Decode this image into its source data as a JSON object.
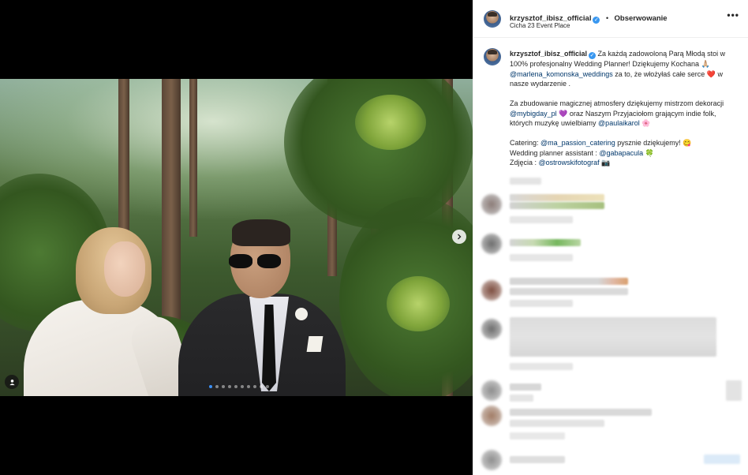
{
  "header": {
    "username": "krzysztof_ibisz_official",
    "verified_mark": "✓",
    "separator": "•",
    "follow_label": "Obserwowanie",
    "location": "Cicha 23 Event Place",
    "more_label": "•••"
  },
  "media": {
    "carousel_count": 10,
    "active_index": 0,
    "next_icon": "chevron-right-icon",
    "tag_icon": "user-tag-icon"
  },
  "caption": {
    "username": "krzysztof_ibisz_official",
    "p1_a": " Za każdą zadowoloną Parą Młodą stoi w 100% profesjonalny Wedding Planner! Dziękujemy Kochana ",
    "p1_emoji1": "🙏🏼",
    "p1_mention": "@marlena_komonska_weddings",
    "p1_b": " za to, że włożyłaś całe serce ",
    "p1_heart": "❤️",
    "p1_c": " w nasze wydarzenie .",
    "p2_a": "Za zbudowanie magicznej atmosfery dziękujemy mistrzom dekoracji ",
    "p2_mention1": "@mybigday_pl",
    "p2_emoji1": "💜",
    "p2_b": " oraz Naszym Przyjaciołom grającym indie folk, których muzykę uwielbiamy ",
    "p2_mention2": "@paulaikarol",
    "p2_emoji2": "🌸",
    "p3_a": "Catering: ",
    "p3_mention": "@ma_passion_catering",
    "p3_b": " pysznie dziękujemy! ",
    "p3_emoji": "😋",
    "p4_a": "Wedding planner assistant : ",
    "p4_mention": "@gabapacula",
    "p4_emoji": "🍀",
    "p5_a": "Zdjęcia : ",
    "p5_mention": "@ostrowskifotograf",
    "p5_emoji": "📷"
  },
  "colors": {
    "link": "#00376b",
    "verified": "#3897f0",
    "carousel_active": "#3b8ff5"
  }
}
